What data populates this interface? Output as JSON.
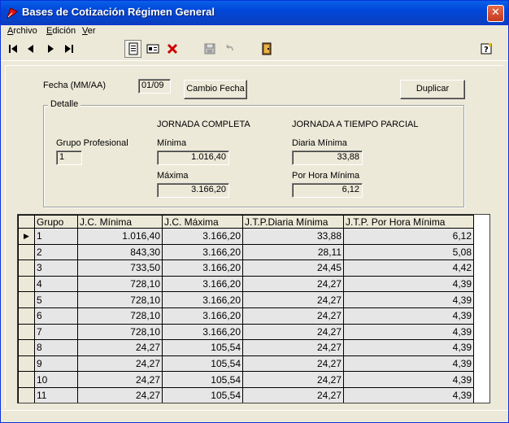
{
  "window": {
    "title": "Bases de Cotización Régimen General",
    "close_glyph": "✕"
  },
  "menu": [
    {
      "label": "Archivo",
      "hotkey": "A",
      "rest": "rchivo"
    },
    {
      "label": "Edición",
      "hotkey": "E",
      "rest": "dición"
    },
    {
      "label": "Ver",
      "hotkey": "V",
      "rest": "er"
    }
  ],
  "toolbar": {
    "first_icon": "first-record-icon",
    "prev_icon": "previous-record-icon",
    "next_icon": "next-record-icon",
    "last_icon": "last-record-icon",
    "new_icon": "new-document-icon",
    "form_icon": "form-view-icon",
    "delete_icon": "delete-icon",
    "save_icon": "save-icon",
    "undo_icon": "undo-icon",
    "exit_icon": "exit-door-icon",
    "help_icon": "help-icon"
  },
  "form": {
    "fecha_label": "Fecha (MM/AA)",
    "fecha_value": "01/09",
    "cambio_fecha_button": "Cambio Fecha",
    "duplicar_button": "Duplicar",
    "detalle_legend": "Detalle",
    "grupo_profesional_label": "Grupo Profesional",
    "grupo_profesional_value": "1",
    "jornada_completa_heading": "JORNADA COMPLETA",
    "jornada_parcial_heading": "JORNADA A TIEMPO PARCIAL",
    "minima_label": "Mínima",
    "minima_value": "1.016,40",
    "maxima_label": "Máxima",
    "maxima_value": "3.166,20",
    "diaria_minima_label": "Diaria Mínima",
    "diaria_minima_value": "33,88",
    "por_hora_minima_label": "Por Hora Mínima",
    "por_hora_minima_value": "6,12"
  },
  "grid": {
    "columns": [
      "Grupo",
      "J.C. Mínima",
      "J.C. Máxima",
      "J.T.P.Diaria Mínima",
      "J.T.P. Por Hora Mínima"
    ],
    "current_row_marker": "▶",
    "rows": [
      [
        "1",
        "1.016,40",
        "3.166,20",
        "33,88",
        "6,12"
      ],
      [
        "2",
        "843,30",
        "3.166,20",
        "28,11",
        "5,08"
      ],
      [
        "3",
        "733,50",
        "3.166,20",
        "24,45",
        "4,42"
      ],
      [
        "4",
        "728,10",
        "3.166,20",
        "24,27",
        "4,39"
      ],
      [
        "5",
        "728,10",
        "3.166,20",
        "24,27",
        "4,39"
      ],
      [
        "6",
        "728,10",
        "3.166,20",
        "24,27",
        "4,39"
      ],
      [
        "7",
        "728,10",
        "3.166,20",
        "24,27",
        "4,39"
      ],
      [
        "8",
        "24,27",
        "105,54",
        "24,27",
        "4,39"
      ],
      [
        "9",
        "24,27",
        "105,54",
        "24,27",
        "4,39"
      ],
      [
        "10",
        "24,27",
        "105,54",
        "24,27",
        "4,39"
      ],
      [
        "11",
        "24,27",
        "105,54",
        "24,27",
        "4,39"
      ]
    ]
  }
}
